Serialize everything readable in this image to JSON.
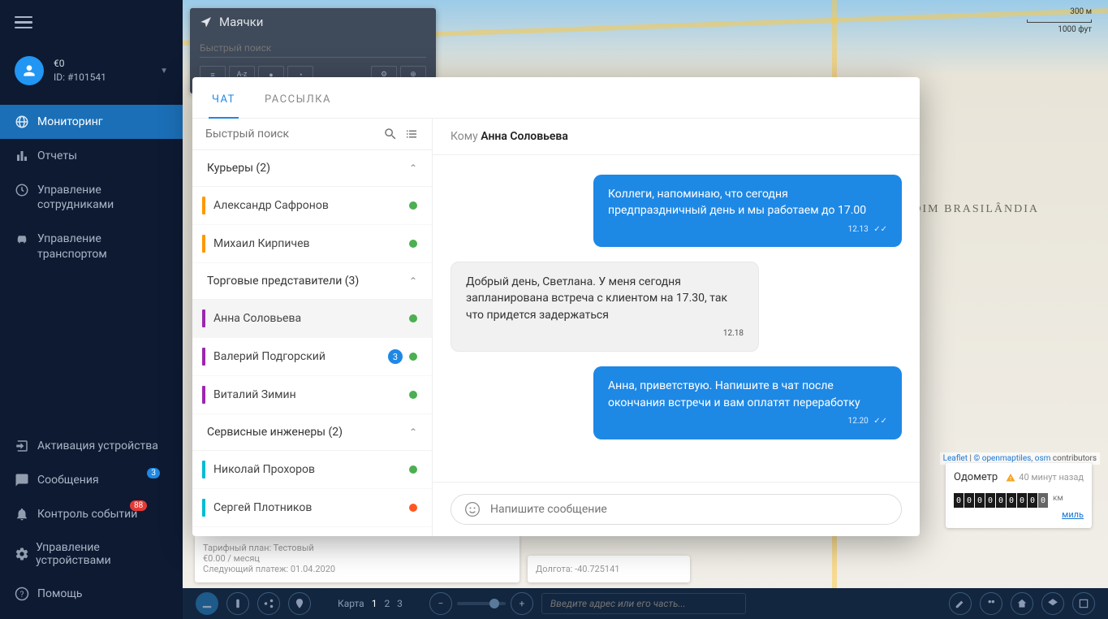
{
  "sidebar": {
    "user": {
      "balance": "€0",
      "id_prefix": "ID:",
      "id": "#101541"
    },
    "nav_main": [
      {
        "label": "Мониторинг",
        "active": true
      },
      {
        "label": "Отчеты"
      },
      {
        "label_line1": "Управление",
        "label_line2": "сотрудниками"
      },
      {
        "label_line1": "Управление",
        "label_line2": "транспортом"
      }
    ],
    "nav_bottom": [
      {
        "label": "Активация устройства"
      },
      {
        "label": "Сообщения",
        "badge": "3"
      },
      {
        "label": "Контроль событий",
        "badge": "88",
        "red": true
      },
      {
        "label": "Управление устройствами"
      },
      {
        "label": "Помощь"
      }
    ]
  },
  "devices_panel": {
    "title": "Маячки",
    "search_placeholder": "Быстрый поиск",
    "sort_label": "A-z"
  },
  "scale": {
    "top": "300 м",
    "bottom": "1000 фут"
  },
  "attribution": {
    "leaflet": "Leaflet",
    "mid": "© openmaptiles, osm",
    "tail": "contributors"
  },
  "district": "JARDIM BRASILÂNDIA",
  "odometer": {
    "title": "Одометр",
    "warning": "40 минут назад",
    "digits": [
      "0",
      "0",
      "0",
      "0",
      "0",
      "0",
      "0",
      "0",
      "0"
    ],
    "unit": "км",
    "link": "миль"
  },
  "device_details": {
    "tariff": "Тарифный план: Тестовый",
    "price": "€0.00 / месяц",
    "next": "Следующий платеж: 01.04.2020",
    "lon": "Долгота: -40.725141"
  },
  "bottom_bar": {
    "map_label": "Карта",
    "maps": [
      "1",
      "2",
      "3"
    ],
    "address_placeholder": "Введите адрес или его часть..."
  },
  "chat": {
    "tabs": [
      "ЧАТ",
      "РАССЫЛКА"
    ],
    "search_placeholder": "Быстрый поиск",
    "groups": [
      {
        "name": "Курьеры (2)",
        "color": "#ff9800",
        "items": [
          {
            "name": "Александр Сафронов",
            "status": "#4caf50"
          },
          {
            "name": "Михаил Кирпичев",
            "status": "#4caf50"
          }
        ]
      },
      {
        "name": "Торговые представители (3)",
        "color": "#9c27b0",
        "items": [
          {
            "name": "Анна Соловьева",
            "status": "#4caf50",
            "selected": true
          },
          {
            "name": "Валерий Подгорский",
            "status": "#4caf50",
            "unread": "3"
          },
          {
            "name": "Виталий Зимин",
            "status": "#4caf50"
          }
        ]
      },
      {
        "name": "Сервисные инженеры (2)",
        "color": "#00bcd4",
        "items": [
          {
            "name": "Николай Прохоров",
            "status": "#4caf50"
          },
          {
            "name": "Сергей Плотников",
            "status": "#ff5722"
          }
        ]
      }
    ],
    "recipient_prefix": "Кому ",
    "recipient": "Анна Соловьева",
    "messages": [
      {
        "dir": "out",
        "text": "Коллеги, напоминаю, что сегодня предпраздничный день и мы работаем до 17.00",
        "time": "12.13"
      },
      {
        "dir": "in",
        "text": "Добрый день, Светлана. У меня сегодня запланирована встреча с клиентом на 17.30, так что придется задержаться",
        "time": "12.18"
      },
      {
        "dir": "out",
        "text": "Анна, приветствую. Напишите в чат после окончания встречи и вам оплатят переработку",
        "time": "12.20"
      }
    ],
    "input_placeholder": "Напишите сообщение"
  }
}
